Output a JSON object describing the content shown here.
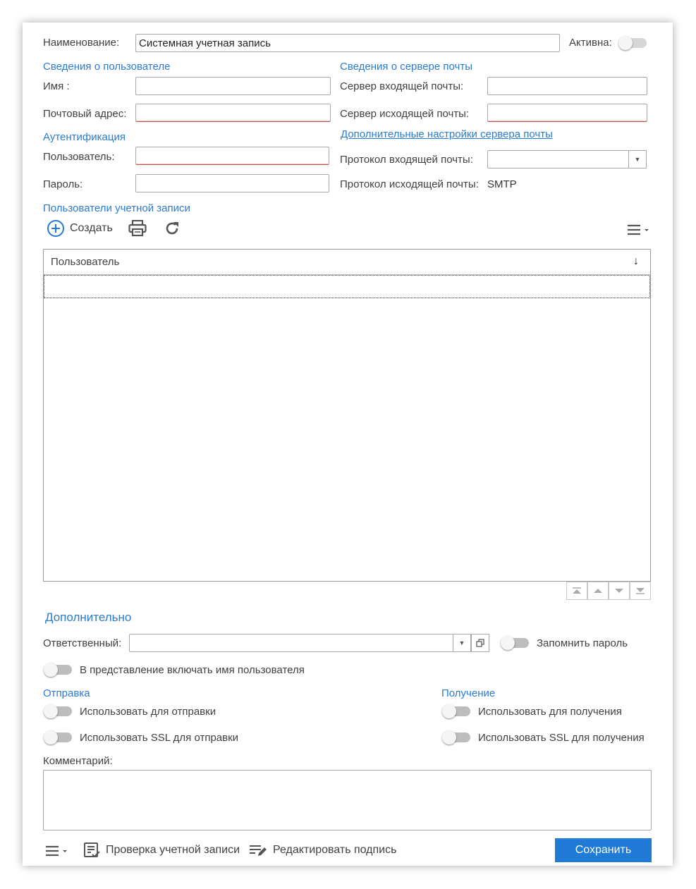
{
  "form": {
    "name_label": "Наименование:",
    "name_value": "Системная учетная запись",
    "active_label": "Активна:"
  },
  "user_info": {
    "title": "Сведения о пользователе",
    "name_label": "Имя :",
    "email_label": "Почтовый адрес:"
  },
  "auth": {
    "title": "Аутентификация",
    "user_label": "Пользователь:",
    "password_label": "Пароль:"
  },
  "mail_server": {
    "title": "Сведения о сервере почты",
    "incoming_label": "Сервер входящей почты:",
    "outgoing_label": "Сервер исходящей почты:",
    "extra_link": "Дополнительные настройки сервера почты",
    "incoming_protocol_label": "Протокол входящей почты:",
    "outgoing_protocol_label": "Протокол исходящей почты:",
    "outgoing_protocol_value": "SMTP"
  },
  "account_users": {
    "title": "Пользователи учетной записи",
    "create_label": "Создать",
    "column_user": "Пользователь",
    "sort_arrow": "↓"
  },
  "additional": {
    "title": "Дополнительно",
    "responsible_label": "Ответственный:",
    "remember_password_label": "Запомнить пароль",
    "include_username_label": "В представление включать имя пользователя"
  },
  "sending": {
    "title": "Отправка",
    "use_for_sending": "Использовать для отправки",
    "use_ssl_sending": "Использовать SSL для отправки"
  },
  "receiving": {
    "title": "Получение",
    "use_for_receiving": "Использовать для получения",
    "use_ssl_receiving": "Использовать SSL для получения"
  },
  "comment": {
    "label": "Комментарий:"
  },
  "footer": {
    "check_account": "Проверка учетной записи",
    "edit_signature": "Редактировать подпись",
    "save": "Сохранить"
  },
  "colors": {
    "accent": "#1f7bd6",
    "section_title": "#2b7bd0",
    "required_underline": "#c0504d"
  }
}
